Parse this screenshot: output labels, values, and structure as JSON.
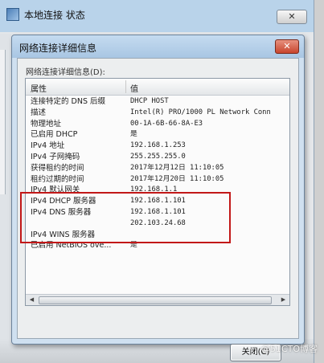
{
  "outer_window": {
    "title": "本地连接 状态",
    "close_label": "✕"
  },
  "dialog": {
    "title": "网络连接详细信息",
    "close_label": "✕",
    "section_label": "网络连接详细信息(D):",
    "columns": [
      "属性",
      "值"
    ],
    "rows": [
      {
        "prop": "连接特定的 DNS 后缀",
        "val": "DHCP HOST"
      },
      {
        "prop": "描述",
        "val": "Intel(R) PRO/1000 PL Network Conn"
      },
      {
        "prop": "物理地址",
        "val": "00-1A-6B-66-8A-E3"
      },
      {
        "prop": "已启用 DHCP",
        "val": "是"
      },
      {
        "prop": "IPv4 地址",
        "val": "192.168.1.253"
      },
      {
        "prop": "IPv4 子网掩码",
        "val": "255.255.255.0"
      },
      {
        "prop": "获得租约的时间",
        "val": "2017年12月12日 11:10:05"
      },
      {
        "prop": "租约过期的时间",
        "val": "2017年12月20日 11:10:05"
      },
      {
        "prop": "IPv4 默认网关",
        "val": "192.168.1.1"
      },
      {
        "prop": "IPv4 DHCP 服务器",
        "val": "192.168.1.101"
      },
      {
        "prop": "IPv4 DNS 服务器",
        "val": "192.168.1.101"
      },
      {
        "prop": "",
        "val": "202.103.24.68"
      },
      {
        "prop": "IPv4 WINS 服务器",
        "val": ""
      },
      {
        "prop": "已启用 NetBIOS ove...",
        "val": "是"
      }
    ],
    "close_button": "关闭(C)"
  },
  "watermark": "@51CTO博客",
  "colors": {
    "highlight": "#c21818",
    "title_bar": "#a9c6e3"
  }
}
